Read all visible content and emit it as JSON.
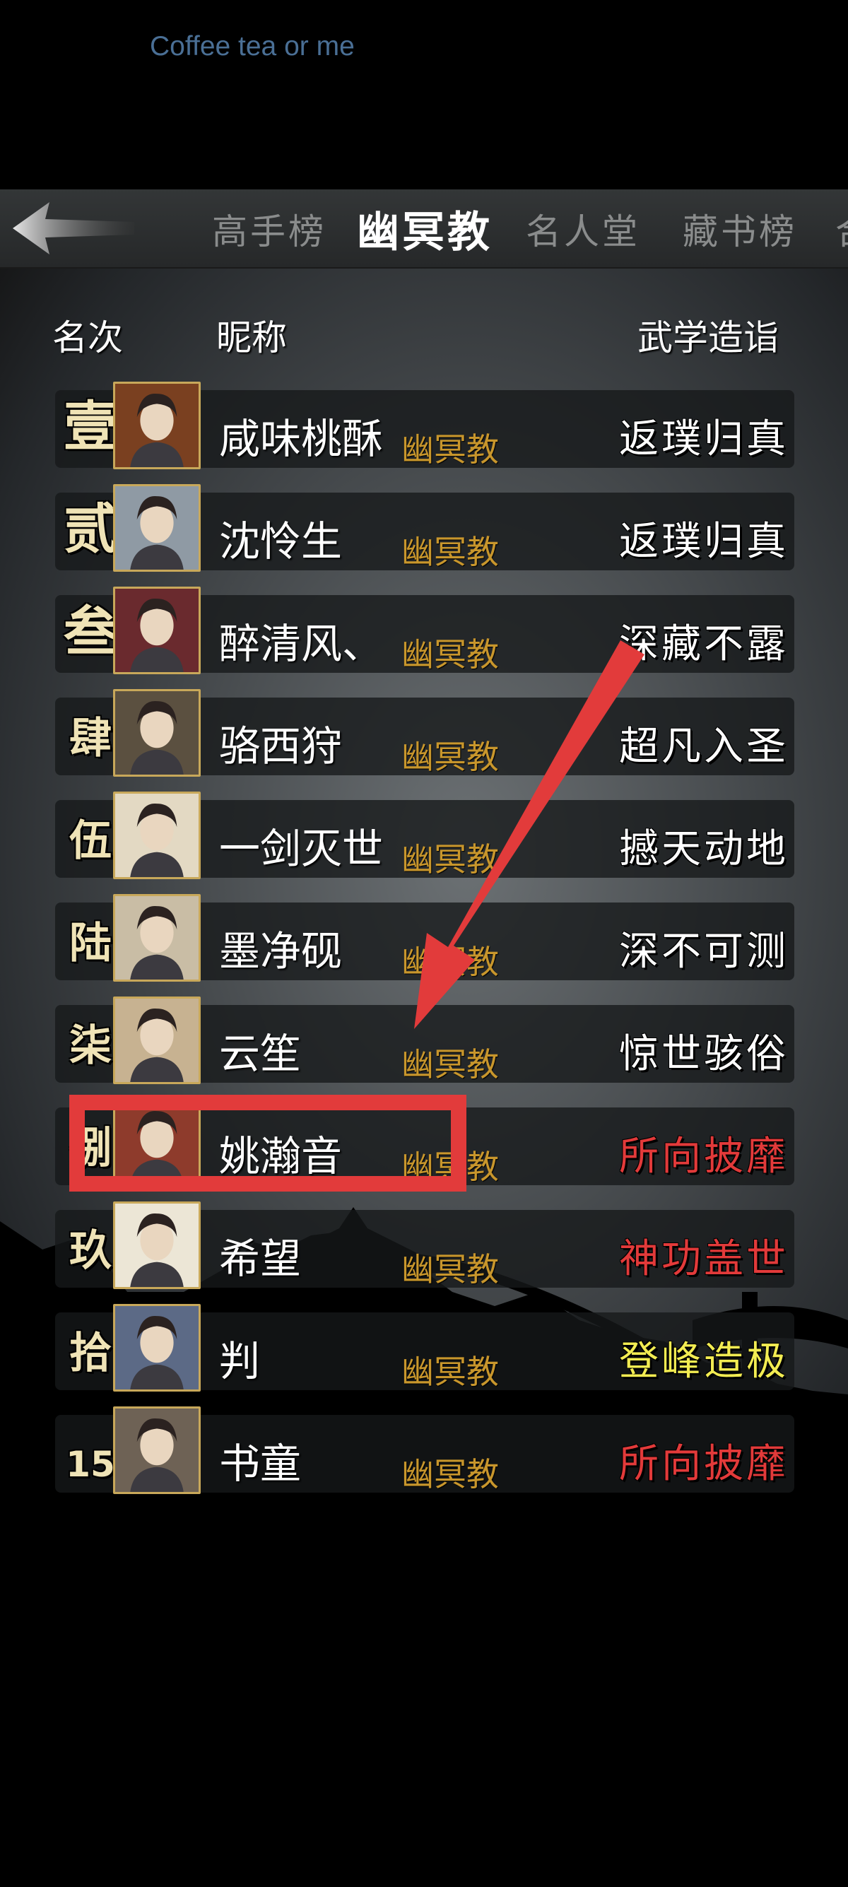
{
  "watermark": "Coffee tea or me",
  "tabs": [
    "高手榜",
    "幽冥教",
    "名人堂",
    "藏书榜"
  ],
  "active_tab": "幽冥教",
  "tab_overflow": "合",
  "headers": {
    "rank": "名次",
    "nickname": "昵称",
    "level": "武学造诣"
  },
  "rows": [
    {
      "rank": "壹",
      "name": "咸味桃酥",
      "sect": "幽冥教",
      "level": "返璞归真",
      "level_color": "#ffffff",
      "avatar_bg": "#7a4020"
    },
    {
      "rank": "贰",
      "name": "沈怜生",
      "sect": "幽冥教",
      "level": "返璞归真",
      "level_color": "#ffffff",
      "avatar_bg": "#8f9aa4"
    },
    {
      "rank": "叁",
      "name": "醉清风、",
      "sect": "幽冥教",
      "level": "深藏不露",
      "level_color": "#ffffff",
      "avatar_bg": "#6a2a2e"
    },
    {
      "rank": "肆",
      "name": "骆西狩",
      "sect": "幽冥教",
      "level": "超凡入圣",
      "level_color": "#ffffff",
      "avatar_bg": "#5b5040"
    },
    {
      "rank": "伍",
      "name": "一剑灭世",
      "sect": "幽冥教",
      "level": "撼天动地",
      "level_color": "#ffffff",
      "avatar_bg": "#e3d9c3"
    },
    {
      "rank": "陆",
      "name": "墨净砚",
      "sect": "幽冥教",
      "level": "深不可测",
      "level_color": "#ffffff",
      "avatar_bg": "#c9bda5"
    },
    {
      "rank": "柒",
      "name": "云笙",
      "sect": "幽冥教",
      "level": "惊世骇俗",
      "level_color": "#ffffff",
      "avatar_bg": "#c7b291"
    },
    {
      "rank": "捌",
      "name": "姚瀚音",
      "sect": "幽冥教",
      "level": "所向披靡",
      "level_color": "#e23a3a",
      "avatar_bg": "#8e3b2c"
    },
    {
      "rank": "玖",
      "name": "希望",
      "sect": "幽冥教",
      "level": "神功盖世",
      "level_color": "#e23a3a",
      "avatar_bg": "#ece6d6"
    },
    {
      "rank": "拾",
      "name": "判",
      "sect": "幽冥教",
      "level": "登峰造极",
      "level_color": "#f2ec52",
      "avatar_bg": "#5c6a86"
    },
    {
      "rank": "15",
      "name": "书童",
      "sect": "幽冥教",
      "level": "所向披靡",
      "level_color": "#e23a3a",
      "avatar_bg": "#6e6255"
    }
  ]
}
